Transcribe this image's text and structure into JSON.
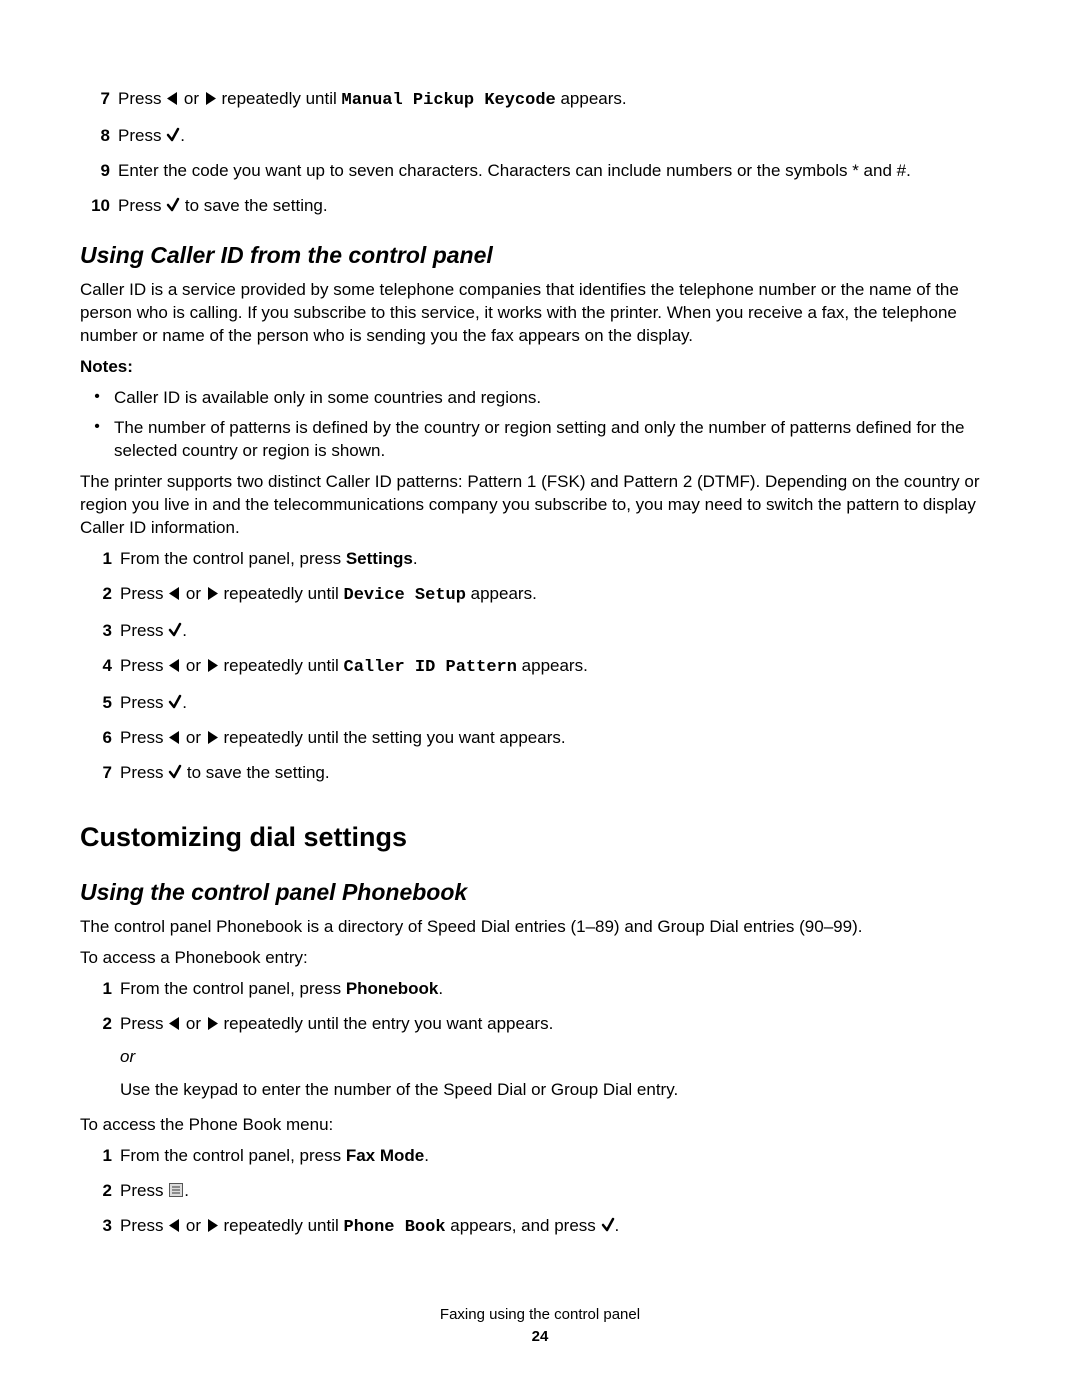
{
  "words": {
    "press": "Press",
    "or": "or",
    "repeat_until": "repeatedly until",
    "appears": "appears.",
    "appears_and_press": "appears, and press",
    "save": "to save the setting.",
    "from_cp_press": "From the control panel, press"
  },
  "top_steps": [
    {
      "n": "7",
      "type": "arrows_until",
      "target": "Manual Pickup Keycode"
    },
    {
      "n": "8",
      "type": "press_check"
    },
    {
      "n": "9",
      "type": "text",
      "text": "Enter the code you want up to seven characters. Characters can include numbers or the symbols * and #."
    },
    {
      "n": "10",
      "type": "press_check_save"
    }
  ],
  "sec1_heading": "Using Caller ID from the control panel",
  "sec1_p1": "Caller ID is a service provided by some telephone companies that identifies the telephone number or the name of the person who is calling. If you subscribe to this service, it works with the printer. When you receive a fax, the telephone number or name of the person who is sending you the fax appears on the display.",
  "notes_label": "Notes:",
  "notes": [
    "Caller ID is available only in some countries and regions.",
    "The number of patterns is defined by the country or region setting and only the number of patterns defined for the selected country or region is shown."
  ],
  "sec1_p2": "The printer supports two distinct Caller ID patterns: Pattern 1 (FSK) and Pattern 2 (DTMF). Depending on the country or region you live in and the telecommunications company you subscribe to, you may need to switch the pattern to display Caller ID information.",
  "sec1_steps": [
    {
      "n": "1",
      "type": "from_cp",
      "bold": "Settings"
    },
    {
      "n": "2",
      "type": "arrows_until",
      "target": "Device Setup"
    },
    {
      "n": "3",
      "type": "press_check"
    },
    {
      "n": "4",
      "type": "arrows_until",
      "target": "Caller ID Pattern"
    },
    {
      "n": "5",
      "type": "press_check"
    },
    {
      "n": "6",
      "type": "arrows_text",
      "text": "repeatedly until the setting you want appears."
    },
    {
      "n": "7",
      "type": "press_check_save"
    }
  ],
  "h_custom": "Customizing dial settings",
  "sec2_heading": "Using the control panel Phonebook",
  "sec2_p1": "The control panel Phonebook is a directory of Speed Dial entries (1–89) and Group Dial entries (90–99).",
  "sec2_p2": "To access a Phonebook entry:",
  "sec2_steps_a": [
    {
      "n": "1",
      "type": "from_cp",
      "bold": "Phonebook"
    },
    {
      "n": "2",
      "type": "arrows_text_or",
      "text": "repeatedly until the entry you want appears.",
      "or": "or",
      "cont": "Use the keypad to enter the number of the Speed Dial or Group Dial entry."
    }
  ],
  "sec2_p3": "To access the Phone Book menu:",
  "sec2_steps_b": [
    {
      "n": "1",
      "type": "from_cp",
      "bold": "Fax Mode"
    },
    {
      "n": "2",
      "type": "press_menu"
    },
    {
      "n": "3",
      "type": "arrows_until_press",
      "target": "Phone Book"
    }
  ],
  "footer_text": "Faxing using the control panel",
  "page_number": "24"
}
